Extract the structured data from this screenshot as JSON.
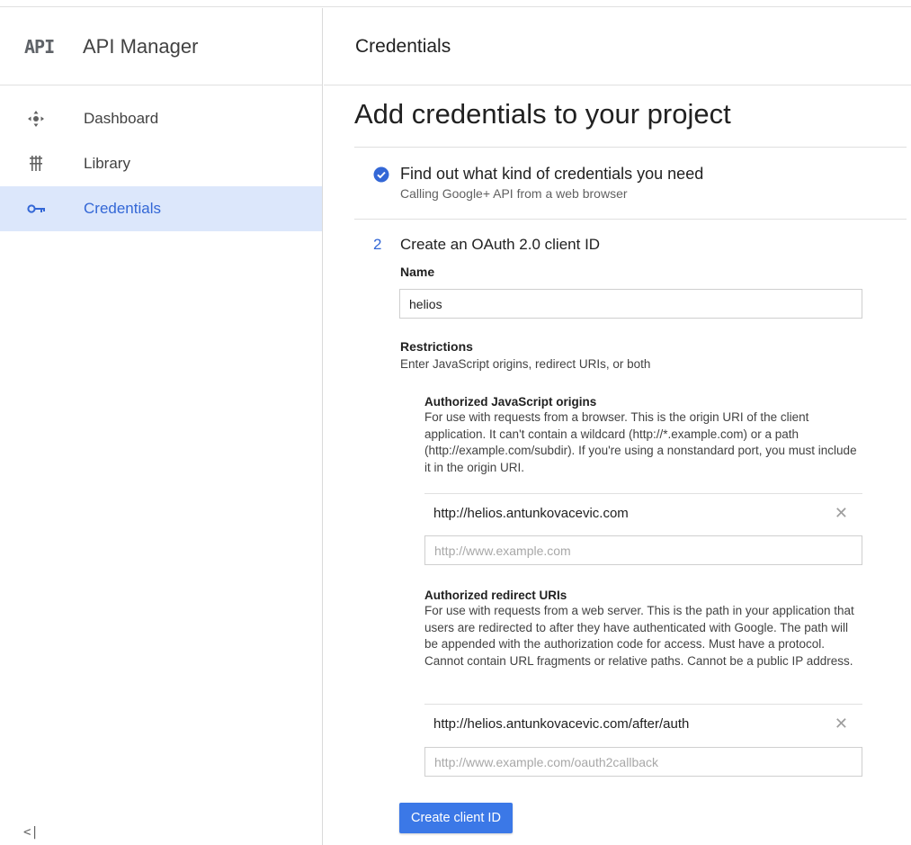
{
  "sidebar": {
    "logo_text": "API",
    "app_title": "API Manager",
    "items": [
      {
        "label": "Dashboard",
        "icon": "dashboard-icon"
      },
      {
        "label": "Library",
        "icon": "library-icon"
      },
      {
        "label": "Credentials",
        "icon": "key-icon",
        "active": true
      }
    ],
    "collapse_label": "<|"
  },
  "header": {
    "title": "Credentials"
  },
  "main": {
    "page_title": "Add credentials to your project",
    "step1": {
      "title": "Find out what kind of credentials you need",
      "subtitle": "Calling Google+ API from a web browser",
      "status": "completed"
    },
    "step2": {
      "number": "2",
      "title": "Create an OAuth 2.0 client ID",
      "name_label": "Name",
      "name_value": "helios",
      "restrictions_label": "Restrictions",
      "restrictions_sub": "Enter JavaScript origins, redirect URIs, or both",
      "js_origins": {
        "title": "Authorized JavaScript origins",
        "description": "For use with requests from a browser. This is the origin URI of the client application. It can't contain a wildcard (http://*.example.com) or a path (http://example.com/subdir). If you're using a nonstandard port, you must include it in the origin URI.",
        "entries": [
          "http://helios.antunkovacevic.com"
        ],
        "placeholder": "http://www.example.com"
      },
      "redirect_uris": {
        "title": "Authorized redirect URIs",
        "description": "For use with requests from a web server. This is the path in your application that users are redirected to after they have authenticated with Google. The path will be appended with the authorization code for access. Must have a protocol. Cannot contain URL fragments or relative paths. Cannot be a public IP address.",
        "entries": [
          "http://helios.antunkovacevic.com/after/auth"
        ],
        "placeholder": "http://www.example.com/oauth2callback"
      },
      "create_button": "Create client ID"
    }
  },
  "colors": {
    "accent": "#3367d6",
    "button": "#3b78e7",
    "active_bg": "#dce7fb"
  }
}
